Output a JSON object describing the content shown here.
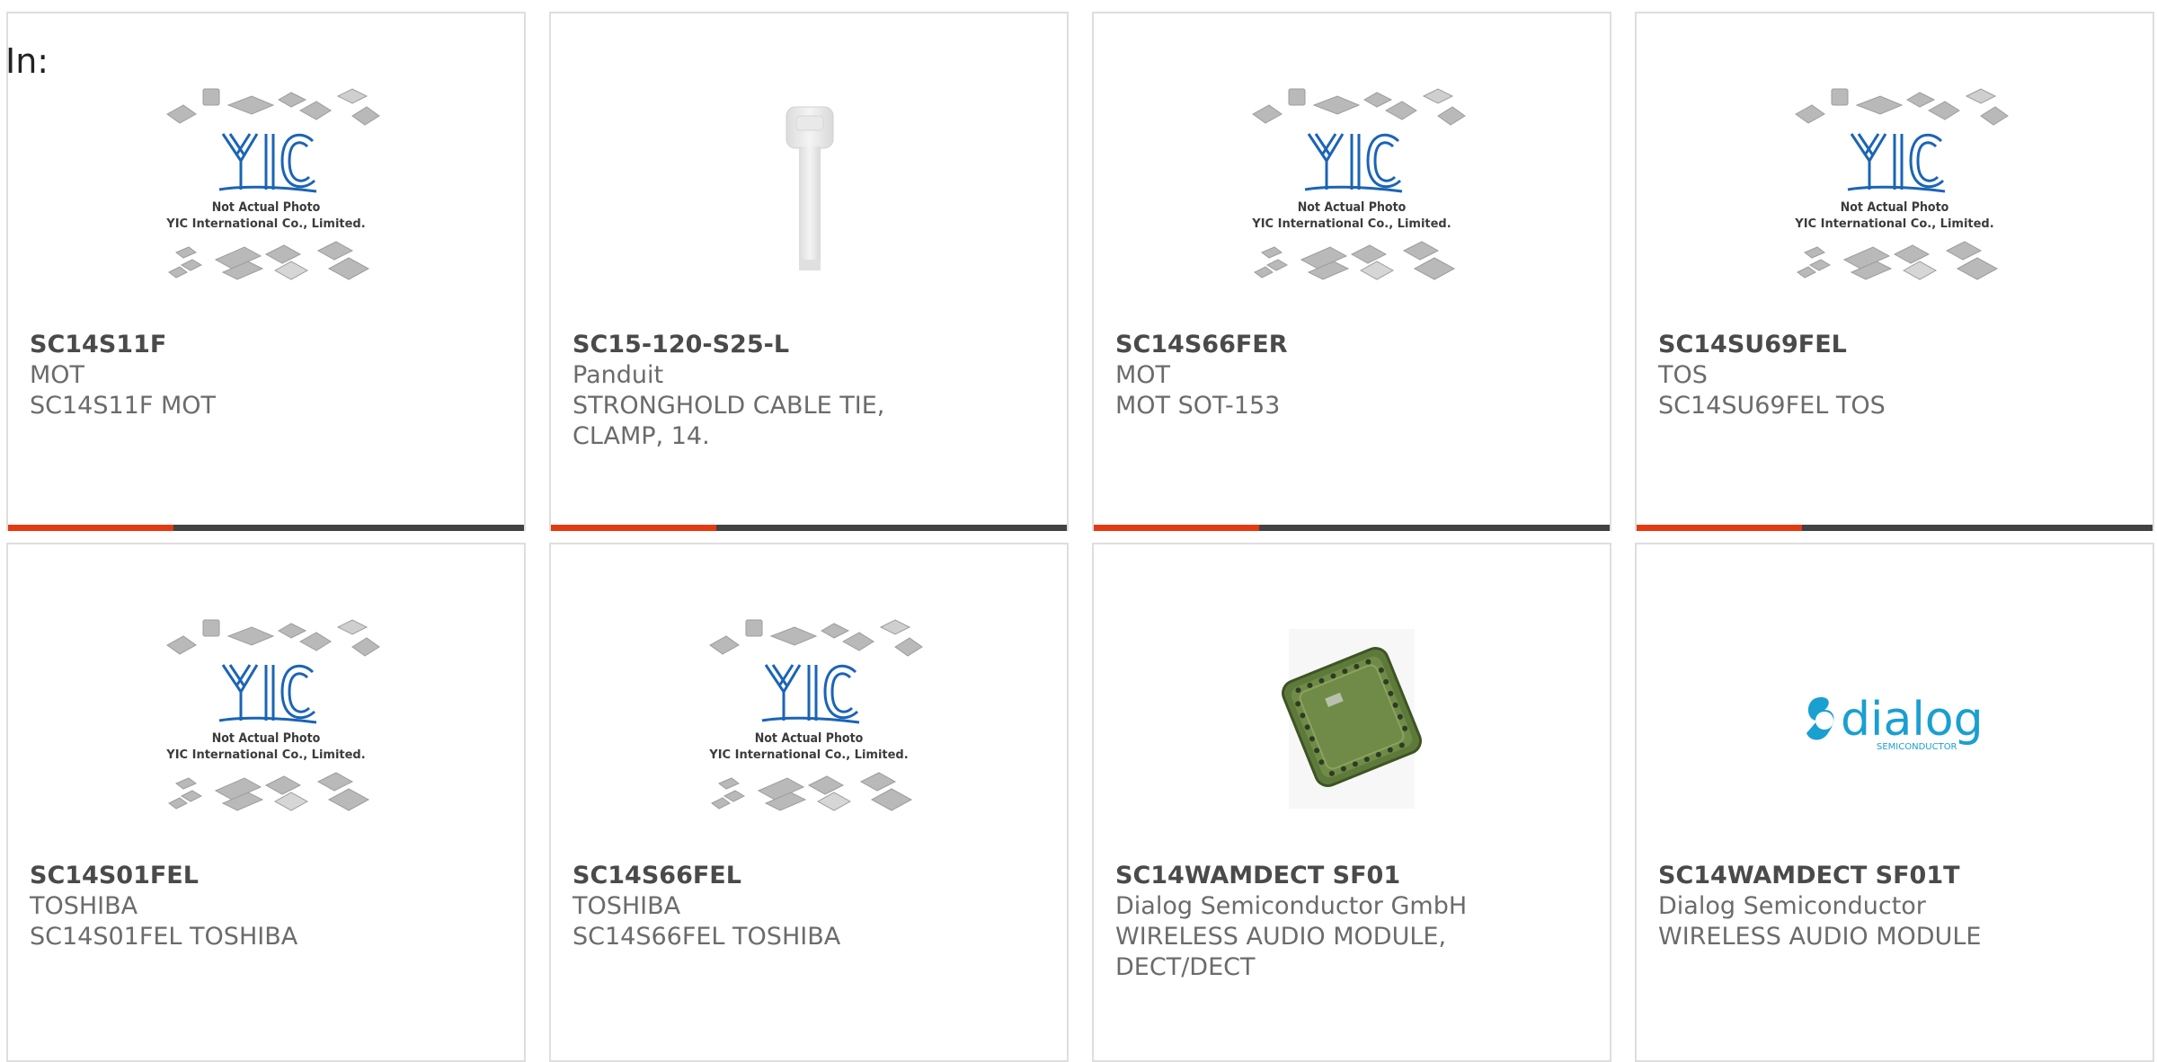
{
  "header": {
    "label": "In:"
  },
  "colors": {
    "accent": "#e33a11",
    "bar": "#424242",
    "card_border": "#dedede",
    "yic_blue": "#1b64b6",
    "dialog_teal": "#1a9fd1"
  },
  "placeholder_image": {
    "logo_text": "YIC",
    "caption_line1": "Not Actual Photo",
    "caption_line2": "YIC International Co., Limited."
  },
  "dialog_logo": {
    "word": "dialog",
    "sub": "SEMICONDUCTOR"
  },
  "products": [
    {
      "part": "SC14S11F",
      "brand": "MOT",
      "description": "SC14S11F MOT",
      "image": "yic-placeholder"
    },
    {
      "part": "SC15-120-S25-L",
      "brand": "Panduit",
      "description": "STRONGHOLD CABLE TIE, CLAMP, 14.",
      "image": "cable-tie-photo"
    },
    {
      "part": "SC14S66FER",
      "brand": "MOT",
      "description": "MOT SOT-153",
      "image": "yic-placeholder"
    },
    {
      "part": "SC14SU69FEL",
      "brand": "TOS",
      "description": "SC14SU69FEL TOS",
      "image": "yic-placeholder"
    },
    {
      "part": "SC14S01FEL",
      "brand": "TOSHIBA",
      "description": "SC14S01FEL TOSHIBA",
      "image": "yic-placeholder"
    },
    {
      "part": "SC14S66FEL",
      "brand": "TOSHIBA",
      "description": "SC14S66FEL TOSHIBA",
      "image": "yic-placeholder"
    },
    {
      "part": "SC14WAMDECT SF01",
      "brand": "Dialog Semiconductor GmbH",
      "description": "WIRELESS AUDIO MODULE, DECT/DECT",
      "image": "module-photo"
    },
    {
      "part": "SC14WAMDECT SF01T",
      "brand": "Dialog Semiconductor",
      "description": "WIRELESS AUDIO MODULE",
      "image": "dialog-logo"
    }
  ]
}
